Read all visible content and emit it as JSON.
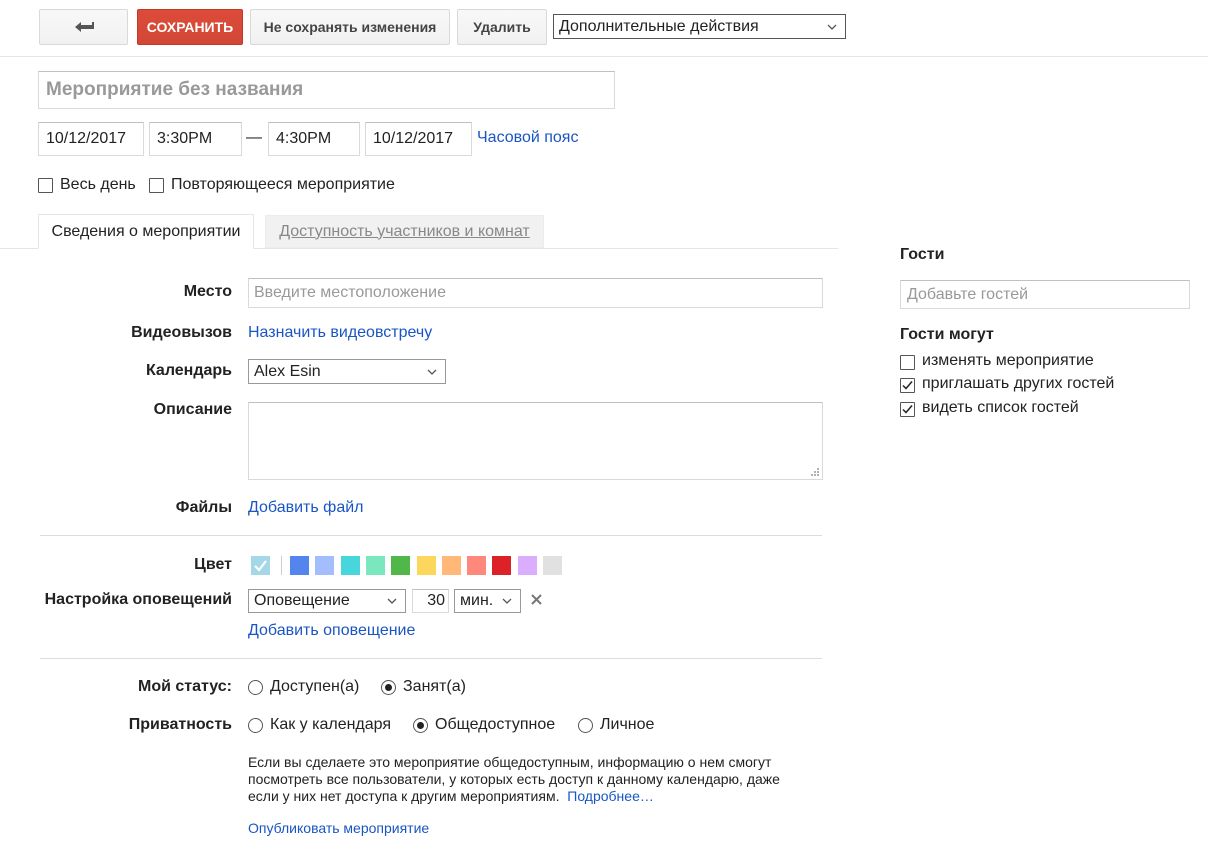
{
  "toolbar": {
    "back_icon": "back-arrow-icon",
    "save_label": "СОХРАНИТЬ",
    "discard_label": "Не сохранять изменения",
    "delete_label": "Удалить",
    "more_actions_value": "Дополнительные действия"
  },
  "event": {
    "title_placeholder": "Мероприятие без названия",
    "start_date": "10/12/2017",
    "start_time": "3:30PM",
    "dash": "—",
    "end_time": "4:30PM",
    "end_date": "10/12/2017",
    "timezone_link": "Часовой пояс",
    "all_day_label": "Весь день",
    "repeat_label": "Повторяющееся мероприятие"
  },
  "tabs": [
    {
      "label": "Сведения о мероприятии",
      "active": true
    },
    {
      "label": "Доступность участников и комнат",
      "active": false
    }
  ],
  "details": {
    "location_label": "Место",
    "location_placeholder": "Введите местоположение",
    "video_label": "Видеовызов",
    "video_link": "Назначить видеовстречу",
    "calendar_label": "Календарь",
    "calendar_value": "Alex Esin",
    "description_label": "Описание",
    "files_label": "Файлы",
    "files_link": "Добавить файл",
    "color_label": "Цвет",
    "colors": [
      "#5484ed",
      "#a4bdfc",
      "#46d6db",
      "#7ae7bf",
      "#51b749",
      "#fbd75b",
      "#ffb878",
      "#ff887c",
      "#dc2127",
      "#dbadff",
      "#e1e1e1"
    ],
    "default_color": "#a4d8e8",
    "notification_label": "Настройка оповещений",
    "notification_type": "Оповещение",
    "notification_amount": "30",
    "notification_unit": "мин.",
    "remove_icon": "close-icon",
    "add_notification_link": "Добавить оповещение",
    "status_label": "Мой статус:",
    "status_options": [
      {
        "label": "Доступен(а)",
        "selected": false
      },
      {
        "label": "Занят(а)",
        "selected": true
      }
    ],
    "privacy_label": "Приватность",
    "privacy_options": [
      {
        "label": "Как у календаря",
        "selected": false
      },
      {
        "label": "Общедоступное",
        "selected": true
      },
      {
        "label": "Личное",
        "selected": false
      }
    ],
    "privacy_note": "Если вы сделаете это мероприятие общедоступным, информацию о нем смогут посмотреть все пользователи, у которых есть доступ к данному календарю, даже если у них нет доступа к другим мероприятиям.",
    "more_link": "Подробнее…",
    "publish_link": "Опубликовать мероприятие"
  },
  "guests": {
    "title": "Гости",
    "add_placeholder": "Добавьте гостей",
    "can_title": "Гости могут",
    "permissions": [
      {
        "label": "изменять мероприятие",
        "checked": false
      },
      {
        "label": "приглашать других гостей",
        "checked": true
      },
      {
        "label": "видеть список гостей",
        "checked": true
      }
    ]
  }
}
